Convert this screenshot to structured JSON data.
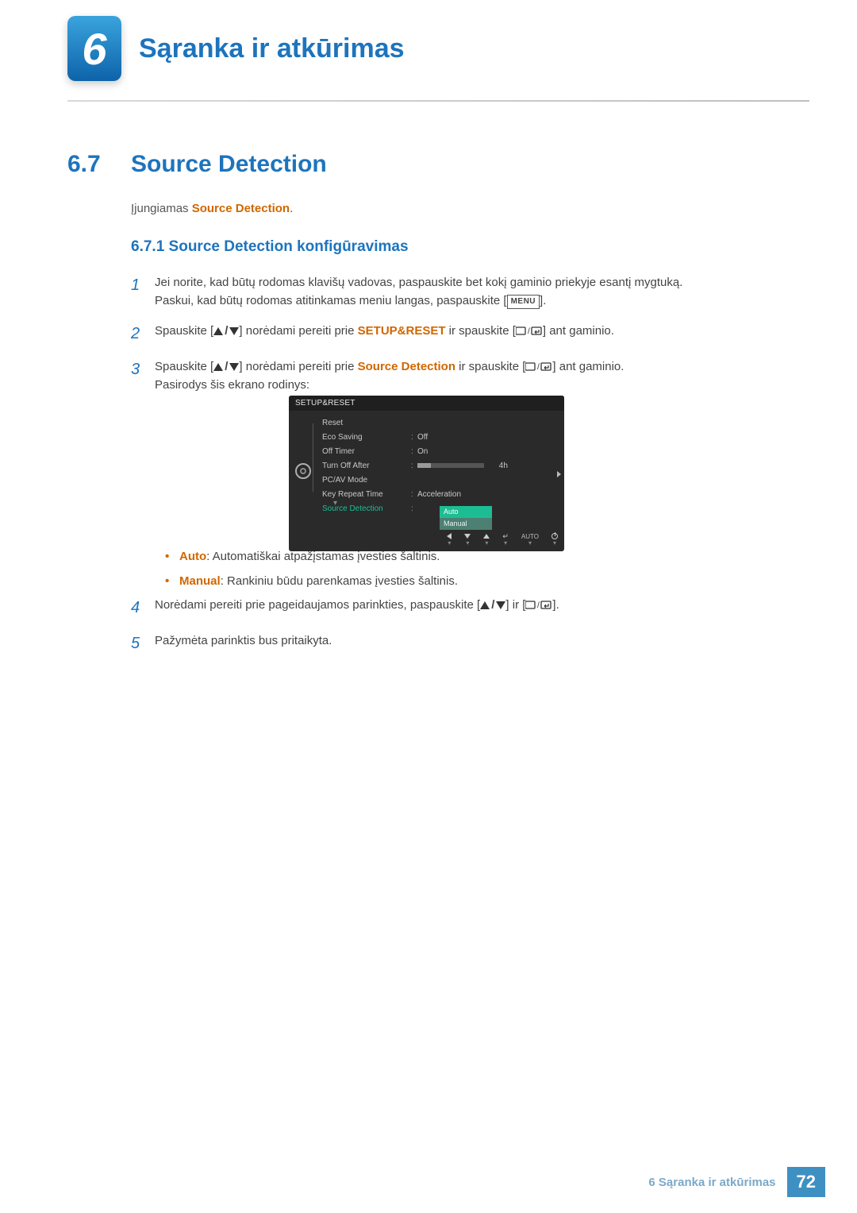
{
  "chapter": {
    "number": "6",
    "title": "Sąranka ir atkūrimas"
  },
  "section": {
    "number": "6.7",
    "title": "Source Detection"
  },
  "intro": {
    "prefix": "Įjungiamas ",
    "keyword": "Source Detection",
    "suffix": "."
  },
  "subsection": {
    "label": "6.7.1 Source Detection konfigūravimas"
  },
  "steps": {
    "s1": {
      "num": "1",
      "line1": "Jei norite, kad būtų rodomas klavišų vadovas, paspauskite bet kokį gaminio priekyje esantį mygtuką.",
      "line2_pre": "Paskui, kad būtų rodomas atitinkamas meniu langas, paspauskite [",
      "menu": "MENU",
      "line2_post": "]."
    },
    "s2": {
      "num": "2",
      "pre": "Spauskite [",
      "mid": "] norėdami pereiti prie ",
      "kw": "SETUP&RESET",
      "post1": " ir spauskite [",
      "post2": "] ant gaminio."
    },
    "s3": {
      "num": "3",
      "pre": "Spauskite [",
      "mid": "] norėdami pereiti prie ",
      "kw": "Source Detection",
      "post1": " ir spauskite [",
      "post2": "] ant gaminio.",
      "tail": "Pasirodys šis ekrano rodinys:"
    },
    "s4": {
      "num": "4",
      "pre": "Norėdami pereiti prie pageidaujamos parinkties, paspauskite [",
      "mid": "] ir [",
      "post": "]."
    },
    "s5": {
      "num": "5",
      "text": "Pažymėta parinktis bus pritaikyta."
    }
  },
  "osd": {
    "title": "SETUP&RESET",
    "rows": {
      "reset": "Reset",
      "eco": "Eco Saving",
      "eco_val": "Off",
      "timer": "Off Timer",
      "timer_val": "On",
      "turnoff": "Turn Off After",
      "turnoff_val": "4h",
      "pcav": "PC/AV Mode",
      "keyrep": "Key Repeat Time",
      "keyrep_val": "Acceleration",
      "srcdet": "Source Detection"
    },
    "dropdown": {
      "auto": "Auto",
      "manual": "Manual"
    },
    "footer": {
      "auto": "AUTO"
    }
  },
  "bullets": {
    "auto_kw": "Auto",
    "auto_txt": ": Automatiškai atpažįstamas įvesties šaltinis.",
    "manual_kw": "Manual",
    "manual_txt": ": Rankiniu būdu parenkamas įvesties šaltinis."
  },
  "footer": {
    "text": "6 Sąranka ir atkūrimas",
    "page": "72"
  }
}
